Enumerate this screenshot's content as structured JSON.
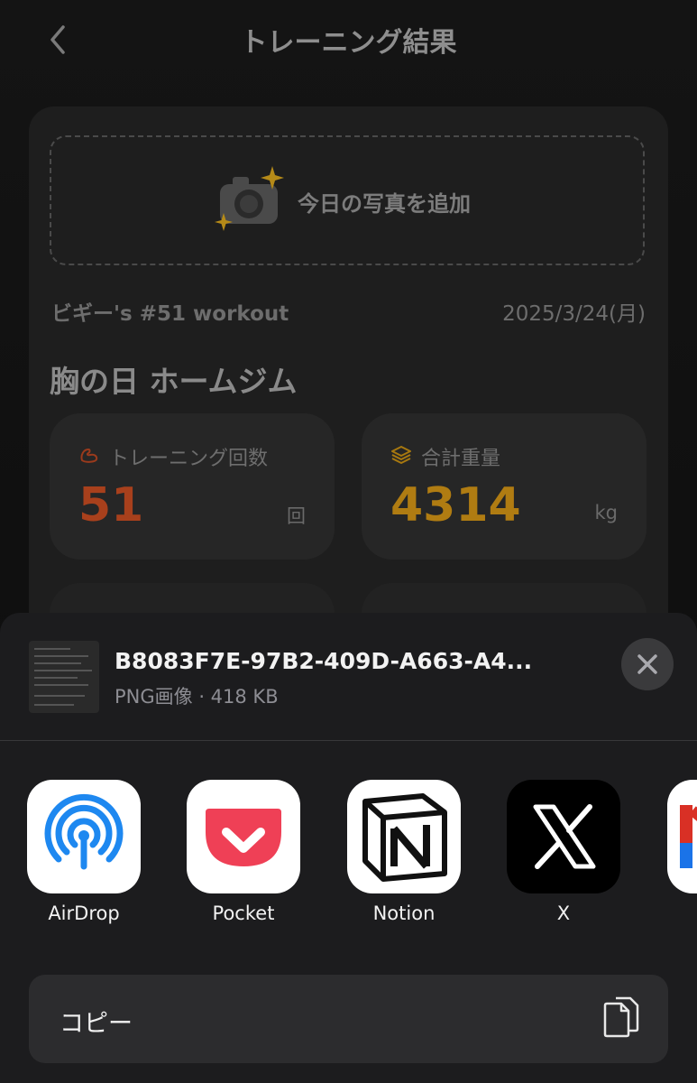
{
  "header": {
    "title": "トレーニング結果",
    "back_icon": "chevron-left-icon"
  },
  "card": {
    "photo_label": "今日の写真を追加",
    "workout_name": "ビギー's #51 workout",
    "workout_date": "2025/3/24(月)",
    "session_title": "胸の日 ホームジム",
    "stats": [
      {
        "label": "トレーニング回数",
        "value": "51",
        "unit": "回",
        "color": "#b8431e",
        "icon": "muscle-icon"
      },
      {
        "label": "合計重量",
        "value": "4314",
        "unit": "kg",
        "color": "#c08712",
        "icon": "layers-icon"
      }
    ]
  },
  "share_sheet": {
    "file_name": "B8083F7E-97B2-409D-A663-A4...",
    "file_meta": "PNG画像 · 418 KB",
    "apps": [
      {
        "label": "AirDrop",
        "icon": "airdrop-icon"
      },
      {
        "label": "Pocket",
        "icon": "pocket-icon"
      },
      {
        "label": "Notion",
        "icon": "notion-icon"
      },
      {
        "label": "X",
        "icon": "x-icon"
      }
    ],
    "copy_label": "コピー"
  }
}
